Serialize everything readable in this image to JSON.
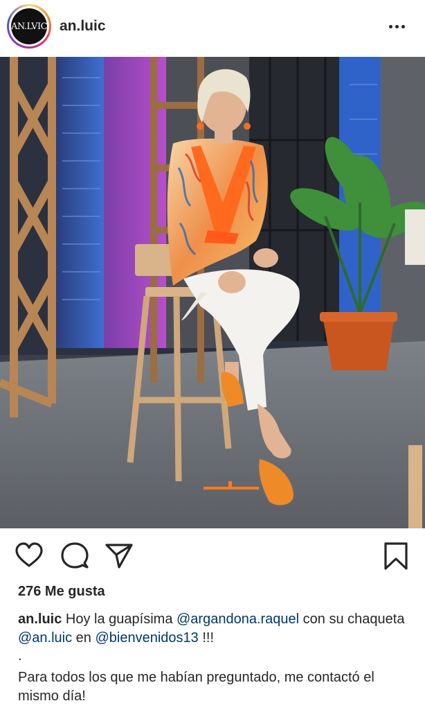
{
  "post": {
    "username": "an.luic",
    "avatar_text": "AN.LVIC",
    "likes": "276 Me gusta",
    "caption": {
      "username": "an.luic",
      "text1": " Hoy la guapísima ",
      "mention1": "@argandona.raquel",
      "text2": " con su chaqueta ",
      "mention2": "@an.luic",
      "text3": " en ",
      "mention3": "@bienvenidos13",
      "text4": " !!!",
      "dot": ".",
      "para": "Para todos los que me habían preguntado, me contactó el mismo día!"
    }
  },
  "icons": {
    "more": "more-options-icon",
    "like": "heart-icon",
    "comment": "comment-icon",
    "share": "paper-plane-icon",
    "save": "bookmark-icon"
  },
  "colors": {
    "mention": "#00376b",
    "text": "#262626",
    "jacket_accent": "#ff6a1f"
  }
}
